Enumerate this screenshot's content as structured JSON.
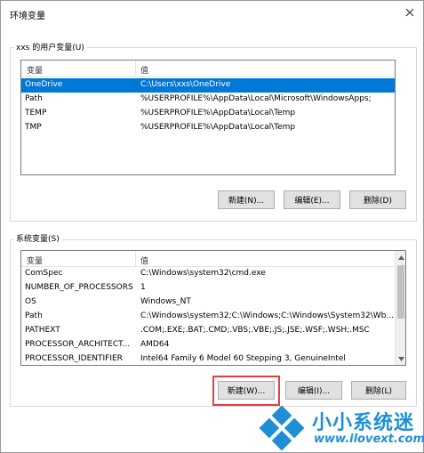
{
  "window": {
    "title": "环境变量"
  },
  "user_vars": {
    "group_label": "xxs 的用户变量(U)",
    "columns": [
      "变量",
      "值"
    ],
    "rows": [
      {
        "name": "OneDrive",
        "value": "C:\\Users\\xxs\\OneDrive",
        "selected": true
      },
      {
        "name": "Path",
        "value": "%USERPROFILE%\\AppData\\Local\\Microsoft\\WindowsApps;"
      },
      {
        "name": "TEMP",
        "value": "%USERPROFILE%\\AppData\\Local\\Temp"
      },
      {
        "name": "TMP",
        "value": "%USERPROFILE%\\AppData\\Local\\Temp"
      }
    ],
    "buttons": {
      "new": "新建(N)...",
      "edit": "编辑(E)...",
      "delete": "删除(D)"
    }
  },
  "system_vars": {
    "group_label": "系统变量(S)",
    "columns": [
      "变量",
      "值"
    ],
    "rows": [
      {
        "name": "ComSpec",
        "value": "C:\\Windows\\system32\\cmd.exe"
      },
      {
        "name": "NUMBER_OF_PROCESSORS",
        "value": "1"
      },
      {
        "name": "OS",
        "value": "Windows_NT"
      },
      {
        "name": "Path",
        "value": "C:\\Windows\\system32;C:\\Windows;C:\\Windows\\System32\\Wb..."
      },
      {
        "name": "PATHEXT",
        "value": ".COM;.EXE;.BAT;.CMD;.VBS;.VBE;.JS;.JSE;.WSF;.WSH;.MSC"
      },
      {
        "name": "PROCESSOR_ARCHITECT...",
        "value": "AMD64"
      },
      {
        "name": "PROCESSOR_IDENTIFIER",
        "value": "Intel64 Family 6 Model 60 Stepping 3, GenuineIntel"
      }
    ],
    "buttons": {
      "new": "新建(W)...",
      "edit": "编辑(I)...",
      "delete": "删除(L)"
    }
  },
  "watermark": {
    "brand": "小小系统迷",
    "url": "www.ilovext.com"
  },
  "colors": {
    "selection": "#0078d7",
    "highlight": "#e04040",
    "brand": "#1e8fd6"
  }
}
